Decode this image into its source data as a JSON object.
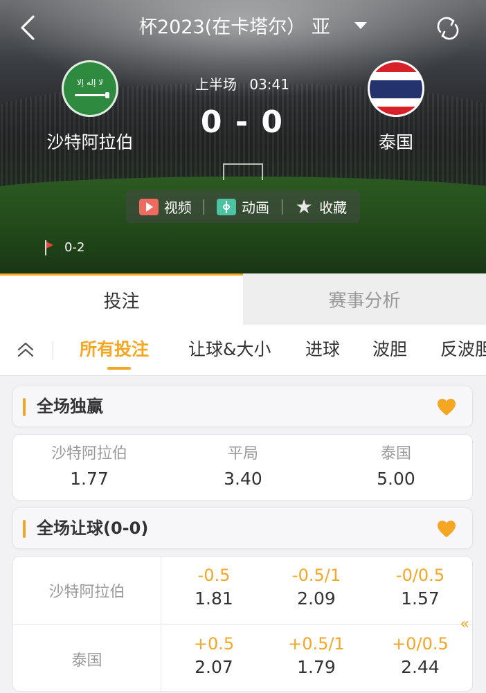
{
  "header": {
    "league_title": "杯2023(在卡塔尔） 亚",
    "icons": {
      "back": "chevron-left-icon",
      "refresh": "refresh-icon",
      "dropdown": "caret-down-icon"
    }
  },
  "match": {
    "home_team": "沙特阿拉伯",
    "away_team": "泰国",
    "period": "上半场",
    "clock": "03:41",
    "score": "0 - 0",
    "corners": "0-2"
  },
  "media": {
    "video_label": "视频",
    "animation_label": "动画",
    "favorite_label": "收藏"
  },
  "main_tabs": [
    {
      "label": "投注",
      "active": true
    },
    {
      "label": "赛事分析",
      "active": false
    }
  ],
  "sub_tabs": [
    {
      "label": "所有投注",
      "active": true
    },
    {
      "label": "让球&大小",
      "active": false
    },
    {
      "label": "进球",
      "active": false
    },
    {
      "label": "波胆",
      "active": false
    },
    {
      "label": "反波胆",
      "active": false
    }
  ],
  "markets": {
    "full_time_winner": {
      "title": "全场独赢",
      "options": [
        {
          "label": "沙特阿拉伯",
          "odds": "1.77"
        },
        {
          "label": "平局",
          "odds": "3.40"
        },
        {
          "label": "泰国",
          "odds": "5.00"
        }
      ]
    },
    "handicap": {
      "title": "全场让球(0-0)",
      "rows": [
        {
          "team": "沙特阿拉伯",
          "cells": [
            {
              "line": "-0.5",
              "odds": "1.81"
            },
            {
              "line": "-0.5/1",
              "odds": "2.09"
            },
            {
              "line": "-0/0.5",
              "odds": "1.57"
            }
          ]
        },
        {
          "team": "泰国",
          "cells": [
            {
              "line": "+0.5",
              "odds": "2.07"
            },
            {
              "line": "+0.5/1",
              "odds": "1.79"
            },
            {
              "line": "+0/0.5",
              "odds": "2.44"
            }
          ]
        }
      ]
    }
  },
  "colors": {
    "accent": "#f5a623",
    "muted_text": "#999999",
    "text": "#333333"
  }
}
